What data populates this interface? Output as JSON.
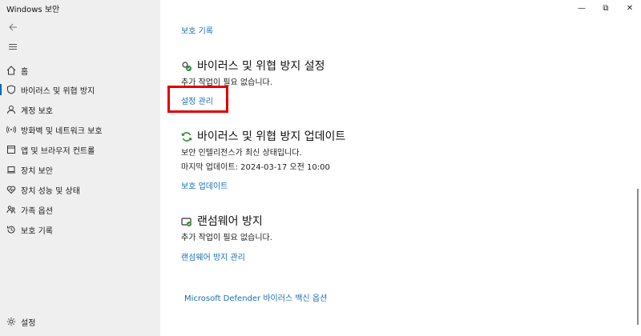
{
  "window": {
    "title": "Windows 보안",
    "controls": {
      "minimize": "—",
      "maximize": "⧉",
      "close": "✕"
    }
  },
  "sidebar": {
    "back_icon": "back-arrow-icon",
    "menu_icon": "hamburger-icon",
    "items": [
      {
        "label": "홈",
        "icon": "home-icon"
      },
      {
        "label": "바이러스 및 위협 방지",
        "icon": "shield-icon",
        "active": true
      },
      {
        "label": "계정 보호",
        "icon": "person-icon"
      },
      {
        "label": "방화벽 및 네트워크 보호",
        "icon": "wifi-icon"
      },
      {
        "label": "앱 및 브라우저 컨트롤",
        "icon": "app-window-icon"
      },
      {
        "label": "장치 보안",
        "icon": "laptop-icon"
      },
      {
        "label": "장치 성능 및 상태",
        "icon": "heart-icon"
      },
      {
        "label": "가족 옵션",
        "icon": "family-icon"
      },
      {
        "label": "보호 기록",
        "icon": "history-icon"
      }
    ],
    "settings_label": "설정"
  },
  "main": {
    "protection_history_link": "보호 기록",
    "settings_section": {
      "title": "바이러스 및 위협 방지 설정",
      "status": "추가 작업이 필요 없습니다.",
      "link": "설정 관리"
    },
    "updates_section": {
      "title": "바이러스 및 위협 방지 업데이트",
      "status": "보안 인텔리전스가 최신 상태입니다.",
      "last_update": "마지막 업데이트: 2024-03-17 오전 10:00",
      "link": "보호 업데이트"
    },
    "ransomware_section": {
      "title": "랜섬웨어 방지",
      "status": "추가 작업이 필요 없습니다.",
      "link": "랜섬웨어 방지 관리"
    },
    "defender_link": "Microsoft Defender 바이러스 백신 옵션"
  },
  "colors": {
    "accent": "#0067c0",
    "link": "#1a6fb5",
    "highlight_box": "#e00000",
    "sidebar_bg": "#efefef"
  }
}
